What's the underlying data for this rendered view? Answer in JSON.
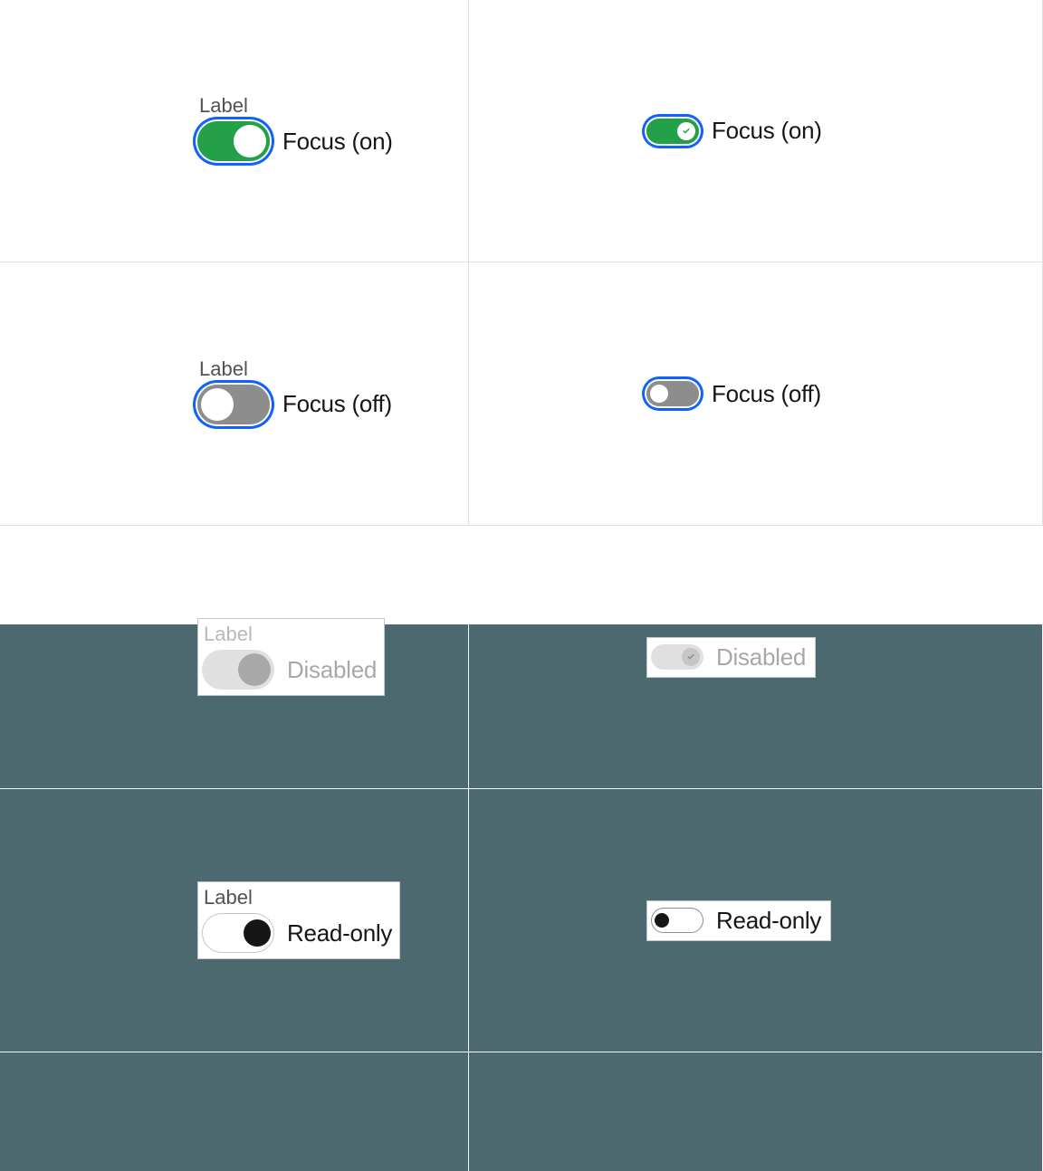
{
  "labels": {
    "field_label": "Label"
  },
  "states": {
    "focus_on": "Focus (on)",
    "focus_off": "Focus (off)",
    "disabled": "Disabled",
    "readonly": "Read-only"
  },
  "toggles": [
    {
      "id": "row1-left",
      "size": "lg",
      "value": true,
      "focused": true,
      "disabled": false,
      "readonly": false,
      "has_label": true,
      "state_key": "focus_on"
    },
    {
      "id": "row1-right",
      "size": "sm",
      "value": true,
      "focused": true,
      "disabled": false,
      "readonly": false,
      "has_label": false,
      "state_key": "focus_on"
    },
    {
      "id": "row2-left",
      "size": "lg",
      "value": false,
      "focused": true,
      "disabled": false,
      "readonly": false,
      "has_label": true,
      "state_key": "focus_off"
    },
    {
      "id": "row2-right",
      "size": "sm",
      "value": false,
      "focused": true,
      "disabled": false,
      "readonly": false,
      "has_label": false,
      "state_key": "focus_off"
    },
    {
      "id": "row3-left",
      "size": "lg",
      "value": true,
      "focused": false,
      "disabled": true,
      "readonly": false,
      "has_label": true,
      "state_key": "disabled"
    },
    {
      "id": "row3-right",
      "size": "sm",
      "value": true,
      "focused": false,
      "disabled": true,
      "readonly": false,
      "has_label": false,
      "state_key": "disabled"
    },
    {
      "id": "row4-left",
      "size": "lg",
      "value": true,
      "focused": false,
      "disabled": false,
      "readonly": true,
      "has_label": true,
      "state_key": "readonly"
    },
    {
      "id": "row4-right",
      "size": "sm",
      "value": false,
      "focused": false,
      "disabled": false,
      "readonly": true,
      "has_label": false,
      "state_key": "readonly"
    }
  ],
  "colors": {
    "on_track": "#24a148",
    "off_track": "#8d8d8d",
    "focus_ring": "#0f62fe",
    "dark_bg": "#4d6970"
  }
}
